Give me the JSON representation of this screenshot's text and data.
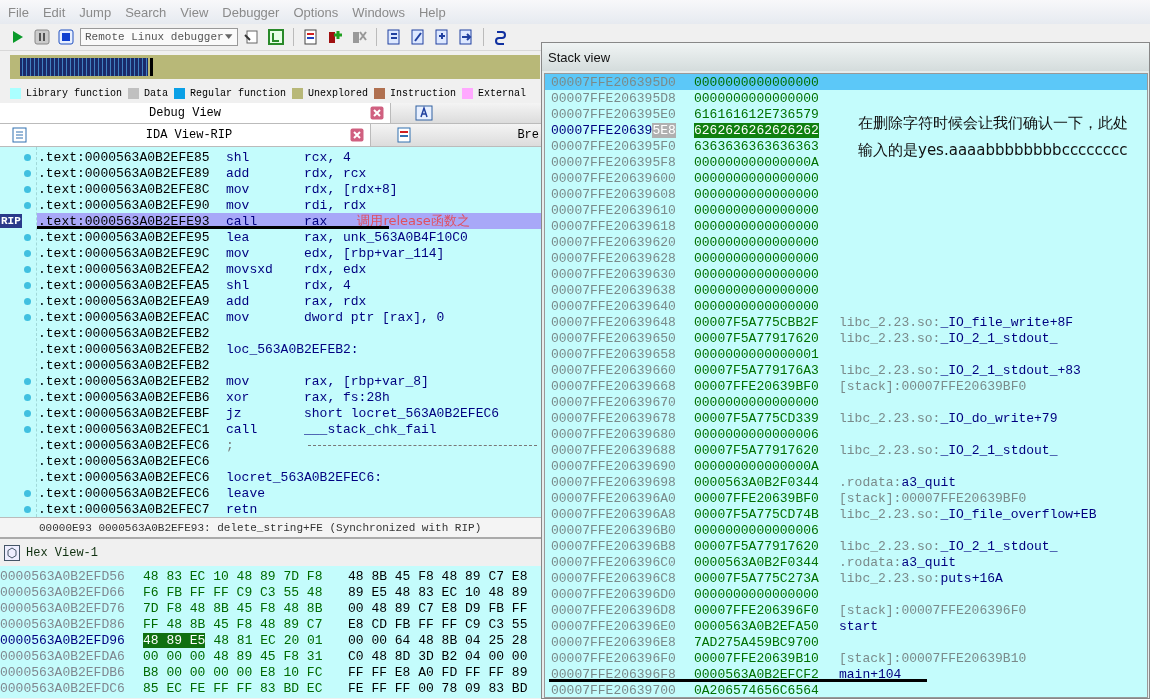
{
  "menu": [
    "File",
    "Edit",
    "Jump",
    "Search",
    "View",
    "Debugger",
    "Options",
    "Windows",
    "Help"
  ],
  "toolbar": {
    "debugger": "Remote Linux debugger"
  },
  "legend": [
    {
      "label": "Library function",
      "color": "#aaffff"
    },
    {
      "label": "Data",
      "color": "#c0c0c0"
    },
    {
      "label": "Regular function",
      "color": "#0aa0e6"
    },
    {
      "label": "Unexplored",
      "color": "#b8b878"
    },
    {
      "label": "Instruction",
      "color": "#b07050"
    },
    {
      "label": "External",
      "color": "#ffa8ff"
    }
  ],
  "debug_view": {
    "title": "Debug View"
  },
  "ida_view": {
    "title": "IDA View-RIP",
    "side_tab": "Bre",
    "lines": [
      {
        "address": ".text:0000563A0B2EFE85",
        "mnemonic": "shl",
        "operands": "rcx, 4",
        "dot": true,
        "current": false,
        "underlined": false
      },
      {
        "address": ".text:0000563A0B2EFE89",
        "mnemonic": "add",
        "operands": "rdx, rcx",
        "dot": true,
        "current": false,
        "underlined": false
      },
      {
        "address": ".text:0000563A0B2EFE8C",
        "mnemonic": "mov",
        "operands": "rdx, [rdx+8]",
        "dot": true,
        "current": false,
        "underlined": false
      },
      {
        "address": ".text:0000563A0B2EFE90",
        "mnemonic": "mov",
        "operands": "rdi, rdx",
        "dot": true,
        "current": false,
        "underlined": false
      },
      {
        "address": ".text:0000563A0B2EFE93",
        "mnemonic": "call",
        "operands": "rax",
        "dot": false,
        "current": true,
        "underlined": true,
        "gutter_label": "RIP",
        "note": "调用release函数之"
      },
      {
        "address": ".text:0000563A0B2EFE95",
        "mnemonic": "lea",
        "operands": "rax, unk_563A0B4F10C0",
        "dot": true,
        "current": false,
        "underlined": false
      },
      {
        "address": ".text:0000563A0B2EFE9C",
        "mnemonic": "mov",
        "operands": "edx, [rbp+var_114]",
        "dot": true,
        "current": false,
        "underlined": false
      },
      {
        "address": ".text:0000563A0B2EFEA2",
        "mnemonic": "movsxd",
        "operands": "rdx, edx",
        "dot": true,
        "current": false,
        "underlined": false
      },
      {
        "address": ".text:0000563A0B2EFEA5",
        "mnemonic": "shl",
        "operands": "rdx, 4",
        "dot": true,
        "current": false,
        "underlined": false
      },
      {
        "address": ".text:0000563A0B2EFEA9",
        "mnemonic": "add",
        "operands": "rax, rdx",
        "dot": true,
        "current": false,
        "underlined": false
      },
      {
        "address": ".text:0000563A0B2EFEAC",
        "mnemonic": "mov",
        "operands": "dword ptr [rax], 0",
        "dot": true,
        "current": false,
        "underlined": false
      },
      {
        "address": ".text:0000563A0B2EFEB2",
        "dot": false,
        "current": false,
        "underlined": false
      },
      {
        "address": ".text:0000563A0B2EFEB2",
        "mnemonic": "loc_563A0B2EFEB2:",
        "dot": false,
        "current": false,
        "underlined": false
      },
      {
        "address": ".text:0000563A0B2EFEB2",
        "dot": false,
        "current": false,
        "underlined": false
      },
      {
        "address": ".text:0000563A0B2EFEB2",
        "mnemonic": "mov",
        "operands": "rax, [rbp+var_8]",
        "dot": true,
        "current": false,
        "underlined": false
      },
      {
        "address": ".text:0000563A0B2EFEB6",
        "mnemonic": "xor",
        "operands": "rax, fs:28h",
        "dot": true,
        "current": false,
        "underlined": false
      },
      {
        "address": ".text:0000563A0B2EFEBF",
        "mnemonic": "jz",
        "operands": "short locret_563A0B2EFEC6",
        "dot": true,
        "current": false,
        "underlined": false
      },
      {
        "address": ".text:0000563A0B2EFEC1",
        "mnemonic": "call",
        "operands": "___stack_chk_fail",
        "dot": true,
        "current": false,
        "underlined": false
      },
      {
        "address": ".text:0000563A0B2EFEC6",
        "mnemonic": ";",
        "separator": true,
        "dot": false,
        "current": false,
        "underlined": false
      },
      {
        "address": ".text:0000563A0B2EFEC6",
        "dot": false,
        "current": false,
        "underlined": false
      },
      {
        "address": ".text:0000563A0B2EFEC6",
        "mnemonic": "locret_563A0B2EFEC6:",
        "dot": false,
        "current": false,
        "underlined": false
      },
      {
        "address": ".text:0000563A0B2EFEC6",
        "mnemonic": "leave",
        "dot": true,
        "current": false,
        "underlined": false
      },
      {
        "address": ".text:0000563A0B2EFEC7",
        "mnemonic": "retn",
        "dot": true,
        "current": false,
        "underlined": false
      }
    ],
    "status": "00000E93 0000563A0B2EFE93: delete_string+FE (Synchronized with RIP)"
  },
  "hex_view": {
    "title": "Hex View-1",
    "rows": [
      {
        "address": "0000563A0B2EFD56",
        "bytes_1": "48 83 EC 10 48 89 7D F8",
        "bytes_2": "48 8B 45 F8 48 89 C7 E8",
        "current": false
      },
      {
        "address": "0000563A0B2EFD66",
        "bytes_1": "F6 FB FF FF C9 C3 55 48",
        "bytes_2": "89 E5 48 83 EC 10 48 89",
        "current": false
      },
      {
        "address": "0000563A0B2EFD76",
        "bytes_1": "7D F8 48 8B 45 F8 48 8B",
        "bytes_2": "00 48 89 C7 E8 D9 FB FF",
        "current": false
      },
      {
        "address": "0000563A0B2EFD86",
        "bytes_1": "FF 48 8B 45 F8 48 89 C7",
        "bytes_2": "E8 CD FB FF FF C9 C3 55",
        "current": false
      },
      {
        "address": "0000563A0B2EFD96",
        "selection": "48 89 E5",
        "bytes_1": "48 81 EC 20 01",
        "bytes_2": "00 00 64 48 8B 04 25 28",
        "current": true
      },
      {
        "address": "0000563A0B2EFDA6",
        "bytes_1": "00 00 00 48 89 45 F8 31",
        "bytes_2": "C0 48 8D 3D B2 04 00 00",
        "current": false
      },
      {
        "address": "0000563A0B2EFDB6",
        "bytes_1": "B8 00 00 00 00 E8 10 FC",
        "bytes_2": "FF FF E8 A0 FD FF FF 89",
        "current": false
      },
      {
        "address": "0000563A0B2EFDC6",
        "bytes_1": "85 EC FE FF FF 83 BD EC",
        "bytes_2": "FE FF FF 00 78 09 83 BD",
        "current": false
      }
    ]
  },
  "stack_view": {
    "title": "Stack view",
    "annotation": [
      "在删除字符时候会让我们确认一下，此处",
      "输入的是yes.aaaabbbbbbbbcccccccc"
    ],
    "rows": [
      {
        "address": "00007FFE206395D0",
        "value": "0000000000000000",
        "selected": true,
        "underlined": false
      },
      {
        "address": "00007FFE206395D8",
        "value": "0000000000000000",
        "selected": false,
        "underlined": false
      },
      {
        "address": "00007FFE206395E0",
        "value": "616161612E736579",
        "selected": false,
        "underlined": false
      },
      {
        "address": "00007FFE20639",
        "cursor": "5E8",
        "value": "6262626262626262",
        "selected": false,
        "underlined": false
      },
      {
        "address": "00007FFE206395F0",
        "value": "6363636363636363",
        "selected": false,
        "underlined": false
      },
      {
        "address": "00007FFE206395F8",
        "value": "000000000000000A",
        "selected": false,
        "underlined": false
      },
      {
        "address": "00007FFE20639600",
        "value": "0000000000000000",
        "selected": false,
        "underlined": false
      },
      {
        "address": "00007FFE20639608",
        "value": "0000000000000000",
        "selected": false,
        "underlined": false
      },
      {
        "address": "00007FFE20639610",
        "value": "0000000000000000",
        "selected": false,
        "underlined": false
      },
      {
        "address": "00007FFE20639618",
        "value": "0000000000000000",
        "selected": false,
        "underlined": false
      },
      {
        "address": "00007FFE20639620",
        "value": "0000000000000000",
        "selected": false,
        "underlined": false
      },
      {
        "address": "00007FFE20639628",
        "value": "0000000000000000",
        "selected": false,
        "underlined": false
      },
      {
        "address": "00007FFE20639630",
        "value": "0000000000000000",
        "selected": false,
        "underlined": false
      },
      {
        "address": "00007FFE20639638",
        "value": "0000000000000000",
        "selected": false,
        "underlined": false
      },
      {
        "address": "00007FFE20639640",
        "value": "0000000000000000",
        "selected": false,
        "underlined": false
      },
      {
        "address": "00007FFE20639648",
        "value": "00007F5A775CBB2F",
        "segment": "libc_2.23.so:",
        "symbol": "_IO_file_write+8F",
        "selected": false,
        "underlined": false
      },
      {
        "address": "00007FFE20639650",
        "value": "00007F5A77917620",
        "segment": "libc_2.23.so:",
        "symbol": "_IO_2_1_stdout_",
        "selected": false,
        "underlined": false
      },
      {
        "address": "00007FFE20639658",
        "value": "0000000000000001",
        "selected": false,
        "underlined": false
      },
      {
        "address": "00007FFE20639660",
        "value": "00007F5A779176A3",
        "segment": "libc_2.23.so:",
        "symbol": "_IO_2_1_stdout_+83",
        "selected": false,
        "underlined": false
      },
      {
        "address": "00007FFE20639668",
        "value": "00007FFE20639BF0",
        "segment": "[stack]:00007FFE20639BF0",
        "selected": false,
        "underlined": false
      },
      {
        "address": "00007FFE20639670",
        "value": "0000000000000000",
        "selected": false,
        "underlined": false
      },
      {
        "address": "00007FFE20639678",
        "value": "00007F5A775CD339",
        "segment": "libc_2.23.so:",
        "symbol": "_IO_do_write+79",
        "selected": false,
        "underlined": false
      },
      {
        "address": "00007FFE20639680",
        "value": "0000000000000006",
        "selected": false,
        "underlined": false
      },
      {
        "address": "00007FFE20639688",
        "value": "00007F5A77917620",
        "segment": "libc_2.23.so:",
        "symbol": "_IO_2_1_stdout_",
        "selected": false,
        "underlined": false
      },
      {
        "address": "00007FFE20639690",
        "value": "000000000000000A",
        "selected": false,
        "underlined": false
      },
      {
        "address": "00007FFE20639698",
        "value": "0000563A0B2F0344",
        "segment": ".rodata:",
        "symbol": "a3_quit",
        "selected": false,
        "underlined": false
      },
      {
        "address": "00007FFE206396A0",
        "value": "00007FFE20639BF0",
        "segment": "[stack]:00007FFE20639BF0",
        "selected": false,
        "underlined": false
      },
      {
        "address": "00007FFE206396A8",
        "value": "00007F5A775CD74B",
        "segment": "libc_2.23.so:",
        "symbol": "_IO_file_overflow+EB",
        "selected": false,
        "underlined": false
      },
      {
        "address": "00007FFE206396B0",
        "value": "0000000000000006",
        "selected": false,
        "underlined": false
      },
      {
        "address": "00007FFE206396B8",
        "value": "00007F5A77917620",
        "segment": "libc_2.23.so:",
        "symbol": "_IO_2_1_stdout_",
        "selected": false,
        "underlined": false
      },
      {
        "address": "00007FFE206396C0",
        "value": "0000563A0B2F0344",
        "segment": ".rodata:",
        "symbol": "a3_quit",
        "selected": false,
        "underlined": false
      },
      {
        "address": "00007FFE206396C8",
        "value": "00007F5A775C273A",
        "segment": "libc_2.23.so:",
        "symbol": "puts+16A",
        "selected": false,
        "underlined": false
      },
      {
        "address": "00007FFE206396D0",
        "value": "0000000000000000",
        "selected": false,
        "underlined": false
      },
      {
        "address": "00007FFE206396D8",
        "value": "00007FFE206396F0",
        "segment": "[stack]:00007FFE206396F0",
        "selected": false,
        "underlined": false
      },
      {
        "address": "00007FFE206396E0",
        "value": "0000563A0B2EFA50",
        "symbol": "start",
        "selected": false,
        "underlined": false
      },
      {
        "address": "00007FFE206396E8",
        "value": "7AD275A459BC9700",
        "selected": false,
        "underlined": false
      },
      {
        "address": "00007FFE206396F0",
        "value": "00007FFE20639B10",
        "segment": "[stack]:00007FFE20639B10",
        "selected": false,
        "underlined": false
      },
      {
        "address": "00007FFE206396F8",
        "value": "0000563A0B2EFCF2",
        "symbol": "main+104",
        "selected": false,
        "underlined": true
      },
      {
        "address": "00007FFE20639700",
        "value": "0A206574656C6564",
        "selected": false,
        "underlined": false
      }
    ]
  }
}
